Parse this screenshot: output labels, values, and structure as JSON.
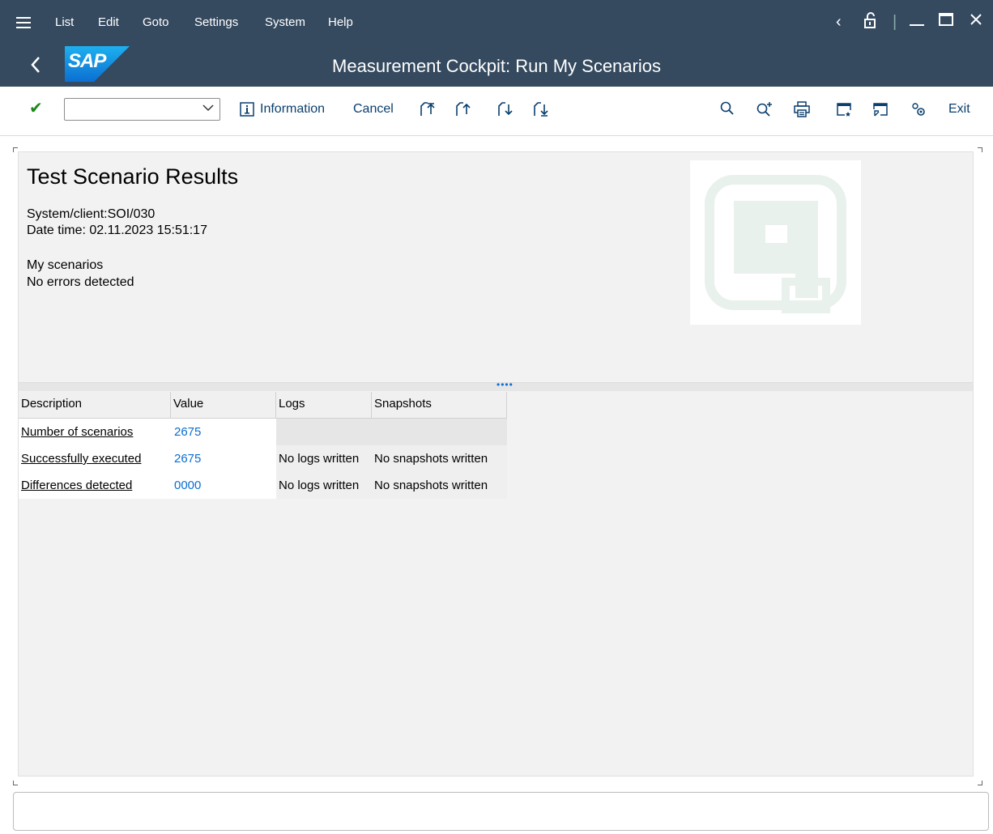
{
  "menu": {
    "items": [
      "List",
      "Edit",
      "Goto",
      "Settings",
      "System",
      "Help"
    ]
  },
  "window": {
    "title": "Measurement Cockpit: Run My Scenarios",
    "logo_text": "SAP"
  },
  "toolbar": {
    "command_value": "",
    "information_label": "Information",
    "cancel_label": "Cancel",
    "exit_label": "Exit"
  },
  "report": {
    "title": "Test Scenario Results",
    "system_client": "System/client:SOI/030",
    "date_time": "Date time: 02.11.2023 15:51:17",
    "scenario_set": "My scenarios",
    "status": "No errors detected"
  },
  "table": {
    "headers": [
      "Description",
      "Value",
      "Logs",
      "Snapshots"
    ],
    "rows": [
      {
        "description": "Number of scenarios",
        "value": "2675",
        "logs": "",
        "snapshots": ""
      },
      {
        "description": "Successfully executed",
        "value": "2675",
        "logs": "No logs written",
        "snapshots": "No snapshots written"
      },
      {
        "description": "Differences detected",
        "value": "0000",
        "logs": "No logs written",
        "snapshots": "No snapshots written"
      }
    ]
  },
  "status_bar": {
    "message": ""
  },
  "colors": {
    "shell": "#354a5f",
    "accent": "#0a6ed1"
  }
}
